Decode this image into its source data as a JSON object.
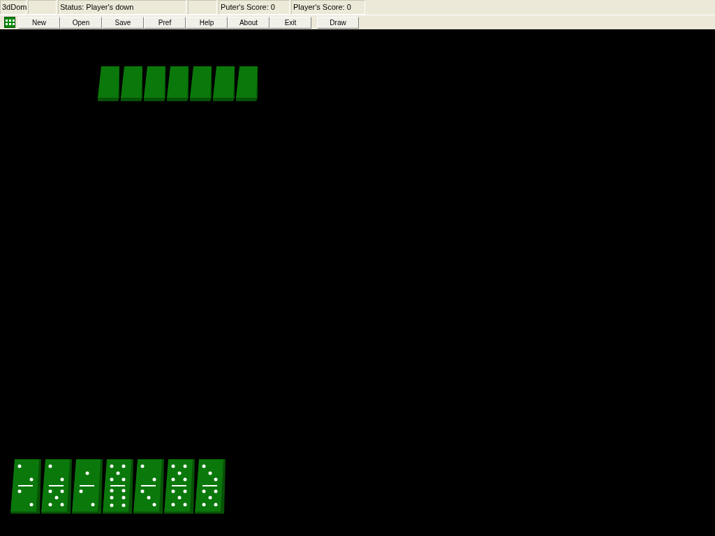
{
  "status_bar": [
    {
      "kind": "text",
      "text": "3dDom"
    },
    {
      "kind": "blank"
    },
    {
      "kind": "text",
      "text": "Status: Player's down"
    },
    {
      "kind": "blank"
    },
    {
      "kind": "text",
      "text": "Puter's Score: 0"
    },
    {
      "kind": "text",
      "text": "Player's Score: 0"
    }
  ],
  "toolbar": {
    "buttons": [
      "New",
      "Open",
      "Save",
      "Pref",
      "Help",
      "About",
      "Exit"
    ],
    "draw_button": "Draw"
  },
  "opponent_hand": [
    {
      "face_down": true
    },
    {
      "face_down": true
    },
    {
      "face_down": true
    },
    {
      "face_down": true
    },
    {
      "face_down": true
    },
    {
      "face_down": true
    },
    {
      "face_down": true
    }
  ],
  "player_hand": [
    {
      "halves": [
        {
          "kind": "two"
        },
        {
          "kind": "two"
        }
      ]
    },
    {
      "halves": [
        {
          "kind": "two"
        },
        {
          "kind": "five"
        }
      ]
    },
    {
      "halves": [
        {
          "kind": "one"
        },
        {
          "kind": "two"
        }
      ]
    },
    {
      "halves": [
        {
          "kind": "five"
        },
        {
          "kind": "six"
        }
      ]
    },
    {
      "halves": [
        {
          "kind": "two"
        },
        {
          "kind": "three"
        }
      ]
    },
    {
      "halves": [
        {
          "kind": "five"
        },
        {
          "kind": "five"
        }
      ]
    },
    {
      "halves": [
        {
          "kind": "three"
        },
        {
          "kind": "five"
        }
      ]
    }
  ]
}
